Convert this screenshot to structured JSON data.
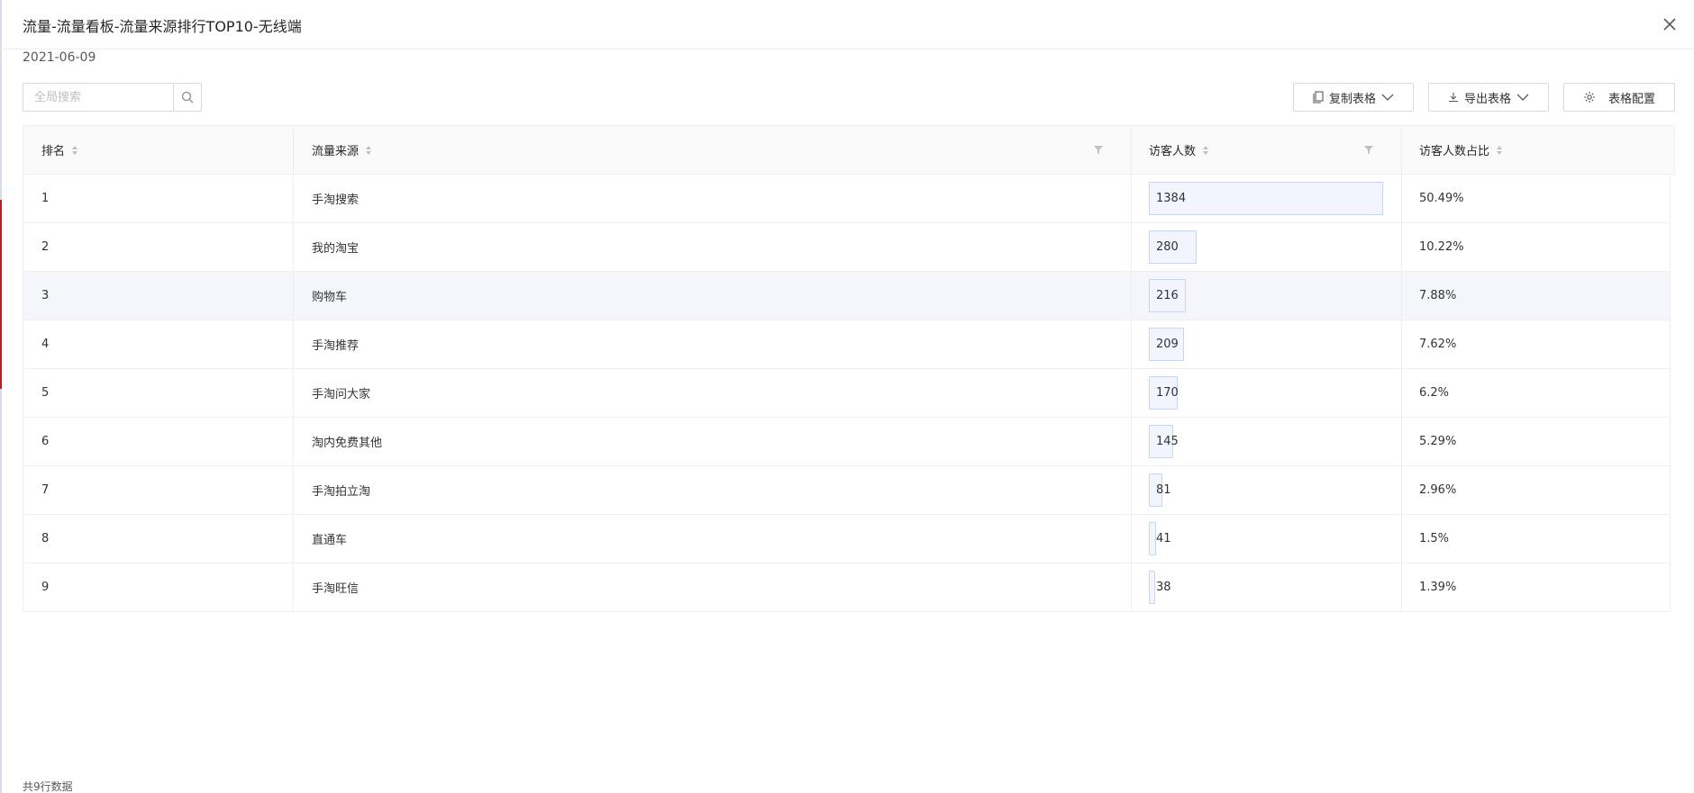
{
  "window": {
    "title": "流量-流量看板-流量来源排行TOP10-无线端",
    "close_icon": "close-icon"
  },
  "date": "2021-06-09",
  "search": {
    "placeholder": "全局搜索",
    "value": "",
    "icon": "search-icon"
  },
  "toolbar": {
    "copy_label": "复制表格",
    "export_label": "导出表格",
    "config_label": "表格配置"
  },
  "table": {
    "columns": [
      "排名",
      "流量来源",
      "访客人数",
      "访客人数占比"
    ],
    "rows": [
      {
        "rank": "1",
        "source": "手淘搜索",
        "visitors": "1384",
        "share": "50.49%"
      },
      {
        "rank": "2",
        "source": "我的淘宝",
        "visitors": "280",
        "share": "10.22%"
      },
      {
        "rank": "3",
        "source": "购物车",
        "visitors": "216",
        "share": "7.88%"
      },
      {
        "rank": "4",
        "source": "手淘推荐",
        "visitors": "209",
        "share": "7.62%"
      },
      {
        "rank": "5",
        "source": "手淘问大家",
        "visitors": "170",
        "share": "6.2%"
      },
      {
        "rank": "6",
        "source": "淘内免费其他",
        "visitors": "145",
        "share": "5.29%"
      },
      {
        "rank": "7",
        "source": "手淘拍立淘",
        "visitors": "81",
        "share": "2.96%"
      },
      {
        "rank": "8",
        "source": "直通车",
        "visitors": "41",
        "share": "1.5%"
      },
      {
        "rank": "9",
        "source": "手淘旺信",
        "visitors": "38",
        "share": "1.39%"
      }
    ],
    "bar_max": 1384,
    "highlighted_row": 3
  },
  "footer": {
    "row_count_text": "共9行数据"
  },
  "colors": {
    "bar_fill": "#f2f5fd",
    "bar_border": "#c9d4ef",
    "row_highlight": "#f4f6fc",
    "header_bg": "#fafafa"
  }
}
